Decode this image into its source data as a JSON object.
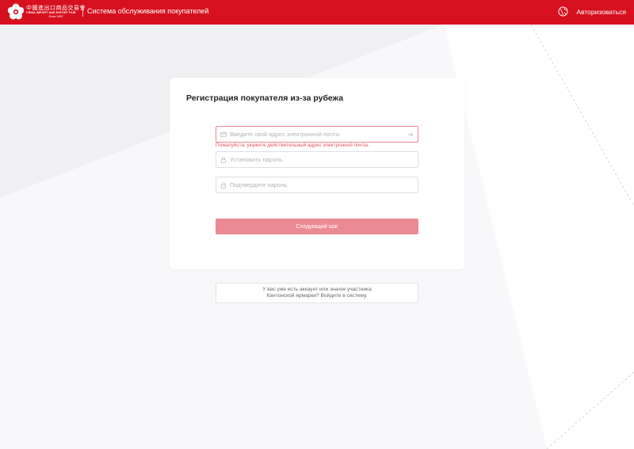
{
  "header": {
    "logo": {
      "cn_text": "中國進出口商品交易會",
      "en_text": "CHINA IMPORT AND EXPORT FAIR",
      "since_text": "Since 1957"
    },
    "title": "Система обслуживания покупателей",
    "login_label": "Авторизоваться",
    "login_icon": "globe-icon"
  },
  "form": {
    "title": "Регистрация покупателя из-за рубежа",
    "email": {
      "placeholder": "Введите свой адрес электронной почты",
      "value": "",
      "icon": "mail-icon",
      "action_icon": "arrow-right-icon"
    },
    "email_error": "Пожалуйста, укажите действительный адрес электронной почты.",
    "password": {
      "placeholder": "Установить пароль.",
      "value": "",
      "icon": "lock-icon"
    },
    "confirm_password": {
      "placeholder": "Подтвердите пароль.",
      "value": "",
      "icon": "lock-icon"
    },
    "next_button": "Следующий шаг"
  },
  "existing_account": {
    "line1": "У вас уже есть аккаунт или значок участника",
    "line2": "Кантонской ярмарки? Войдите в систему."
  },
  "colors": {
    "brand_red": "#d7101f",
    "button_disabled": "#ec8a93",
    "error_text": "#e0525f",
    "page_bg": "#f4f4f6"
  }
}
